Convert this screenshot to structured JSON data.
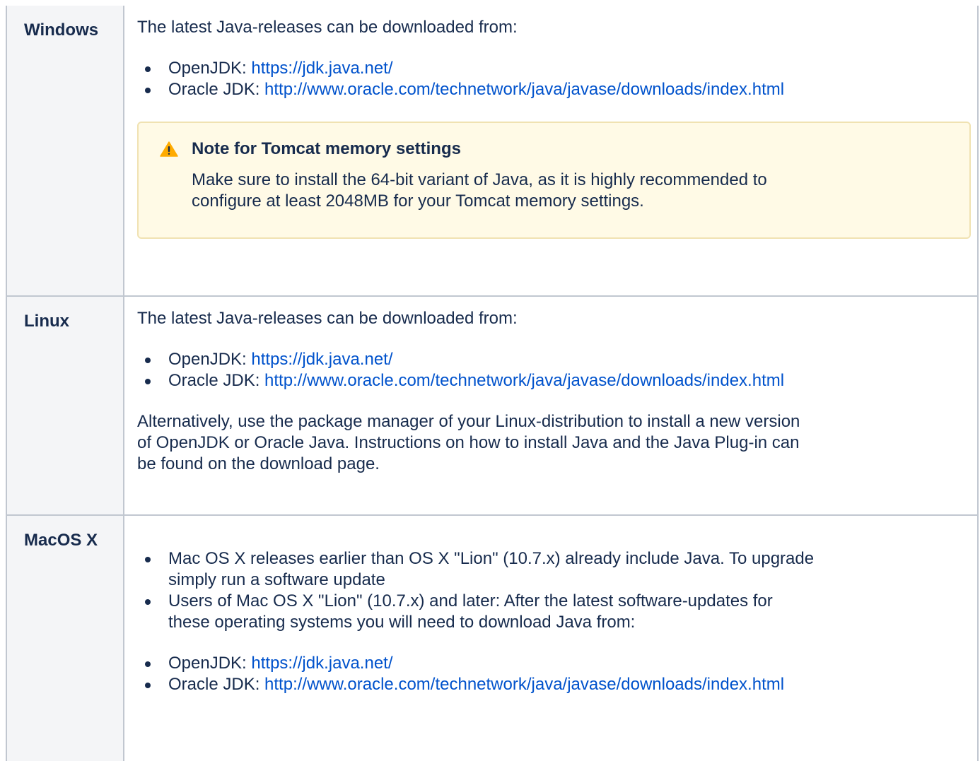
{
  "rows": {
    "windows": {
      "label": "Windows",
      "intro": "The latest Java-releases can be downloaded from:",
      "links": [
        {
          "prefix": "OpenJDK: ",
          "link": "https://jdk.java.net/"
        },
        {
          "prefix": "Oracle JDK: ",
          "link": "http://www.oracle.com/technetwork/java/javase/downloads/index.html"
        }
      ],
      "note": {
        "title": "Note for Tomcat memory settings",
        "text_line1": "Make sure to install the 64-bit variant of Java, as it is highly recommended to",
        "text_line2": "configure at least 2048MB for your Tomcat memory settings.",
        "icon": "warning-icon"
      }
    },
    "linux": {
      "label": "Linux",
      "intro": "The latest Java-releases can be downloaded from:",
      "links": [
        {
          "prefix": "OpenJDK: ",
          "link": "https://jdk.java.net/"
        },
        {
          "prefix": "Oracle JDK: ",
          "link": "http://www.oracle.com/technetwork/java/javase/downloads/index.html"
        }
      ],
      "para_line1": "Alternatively, use the package manager of your Linux-distribution to install a new version",
      "para_line2": "of OpenJDK or Oracle Java. Instructions on how to install Java and the Java Plug-in can",
      "para_line3": "be found on the download page."
    },
    "macos": {
      "label": "MacOS X",
      "items": [
        {
          "line1": "Mac OS X releases earlier than OS X \"Lion\" (10.7.x) already include Java. To upgrade",
          "line2": "simply run a software update"
        },
        {
          "line1": "Users of Mac OS X \"Lion\" (10.7.x) and later: After the latest software-updates for",
          "line2": "these operating systems you will need to download Java from:"
        }
      ],
      "links": [
        {
          "prefix": "OpenJDK: ",
          "link": "https://jdk.java.net/"
        },
        {
          "prefix": "Oracle JDK: ",
          "link": "http://www.oracle.com/technetwork/java/javase/downloads/index.html"
        }
      ]
    }
  },
  "colors": {
    "text": "#172b4d",
    "link": "#0052cc",
    "border": "#c1c7d0",
    "header_bg": "#f4f5f7",
    "note_bg": "#fffae6",
    "note_border": "#f0e2b2",
    "warning": "#ffab00"
  }
}
